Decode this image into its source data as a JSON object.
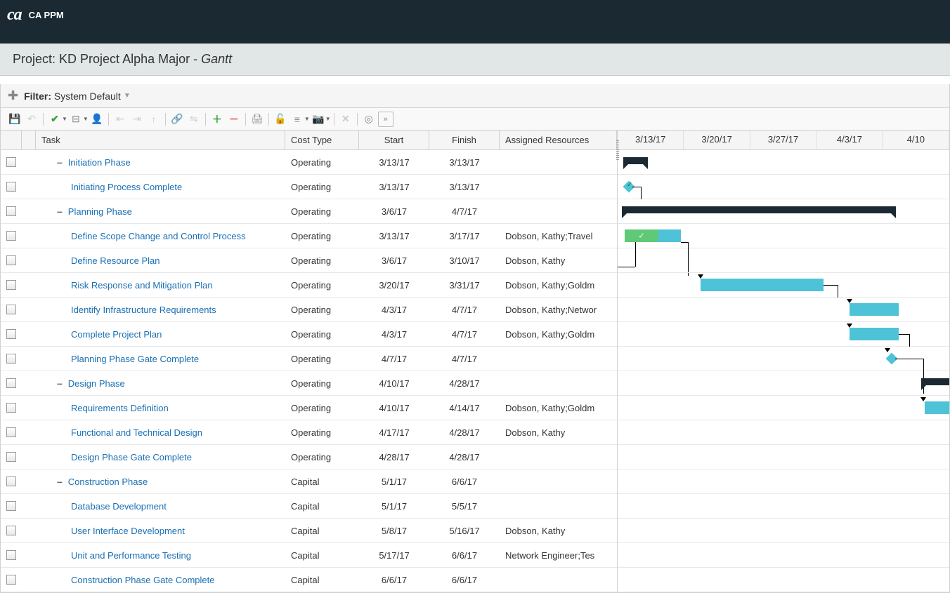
{
  "app": {
    "name": "CA PPM"
  },
  "project": {
    "label_prefix": "Project: ",
    "name": "KD Project Alpha Major",
    "view": "Gantt"
  },
  "filter": {
    "label": "Filter:",
    "value": "System Default"
  },
  "columns": {
    "task": "Task",
    "cost_type": "Cost Type",
    "start": "Start",
    "finish": "Finish",
    "assigned": "Assigned Resources"
  },
  "timeline": {
    "weeks": [
      "3/13/17",
      "3/20/17",
      "3/27/17",
      "4/3/17",
      "4/10"
    ]
  },
  "tasks": [
    {
      "name": "Initiation Phase",
      "cost": "Operating",
      "start": "3/13/17",
      "finish": "3/13/17",
      "assigned": "",
      "level": 1,
      "parent": true
    },
    {
      "name": "Initiating Process Complete",
      "cost": "Operating",
      "start": "3/13/17",
      "finish": "3/13/17",
      "assigned": "",
      "level": 2,
      "parent": false
    },
    {
      "name": "Planning Phase",
      "cost": "Operating",
      "start": "3/6/17",
      "finish": "4/7/17",
      "assigned": "",
      "level": 1,
      "parent": true
    },
    {
      "name": "Define Scope Change and Control Process",
      "cost": "Operating",
      "start": "3/13/17",
      "finish": "3/17/17",
      "assigned": "Dobson, Kathy;Travel",
      "level": 2,
      "parent": false
    },
    {
      "name": "Define Resource Plan",
      "cost": "Operating",
      "start": "3/6/17",
      "finish": "3/10/17",
      "assigned": "Dobson, Kathy",
      "level": 2,
      "parent": false
    },
    {
      "name": "Risk Response and Mitigation Plan",
      "cost": "Operating",
      "start": "3/20/17",
      "finish": "3/31/17",
      "assigned": "Dobson, Kathy;Goldm",
      "level": 2,
      "parent": false
    },
    {
      "name": "Identify Infrastructure Requirements",
      "cost": "Operating",
      "start": "4/3/17",
      "finish": "4/7/17",
      "assigned": "Dobson, Kathy;Networ",
      "level": 2,
      "parent": false
    },
    {
      "name": "Complete Project Plan",
      "cost": "Operating",
      "start": "4/3/17",
      "finish": "4/7/17",
      "assigned": "Dobson, Kathy;Goldm",
      "level": 2,
      "parent": false
    },
    {
      "name": "Planning Phase Gate Complete",
      "cost": "Operating",
      "start": "4/7/17",
      "finish": "4/7/17",
      "assigned": "",
      "level": 2,
      "parent": false
    },
    {
      "name": "Design Phase",
      "cost": "Operating",
      "start": "4/10/17",
      "finish": "4/28/17",
      "assigned": "",
      "level": 1,
      "parent": true
    },
    {
      "name": "Requirements Definition",
      "cost": "Operating",
      "start": "4/10/17",
      "finish": "4/14/17",
      "assigned": "Dobson, Kathy;Goldm",
      "level": 2,
      "parent": false
    },
    {
      "name": "Functional and Technical Design",
      "cost": "Operating",
      "start": "4/17/17",
      "finish": "4/28/17",
      "assigned": "Dobson, Kathy",
      "level": 2,
      "parent": false
    },
    {
      "name": "Design Phase Gate Complete",
      "cost": "Operating",
      "start": "4/28/17",
      "finish": "4/28/17",
      "assigned": "",
      "level": 2,
      "parent": false
    },
    {
      "name": "Construction Phase",
      "cost": "Capital",
      "start": "5/1/17",
      "finish": "6/6/17",
      "assigned": "",
      "level": 1,
      "parent": true
    },
    {
      "name": "Database Development",
      "cost": "Capital",
      "start": "5/1/17",
      "finish": "5/5/17",
      "assigned": "",
      "level": 2,
      "parent": false
    },
    {
      "name": "User Interface Development",
      "cost": "Capital",
      "start": "5/8/17",
      "finish": "5/16/17",
      "assigned": "Dobson, Kathy",
      "level": 2,
      "parent": false
    },
    {
      "name": "Unit and Performance Testing",
      "cost": "Capital",
      "start": "5/17/17",
      "finish": "6/6/17",
      "assigned": "Network Engineer;Tes",
      "level": 2,
      "parent": false
    },
    {
      "name": "Construction Phase Gate Complete",
      "cost": "Capital",
      "start": "6/6/17",
      "finish": "6/6/17",
      "assigned": "",
      "level": 2,
      "parent": false
    }
  ]
}
